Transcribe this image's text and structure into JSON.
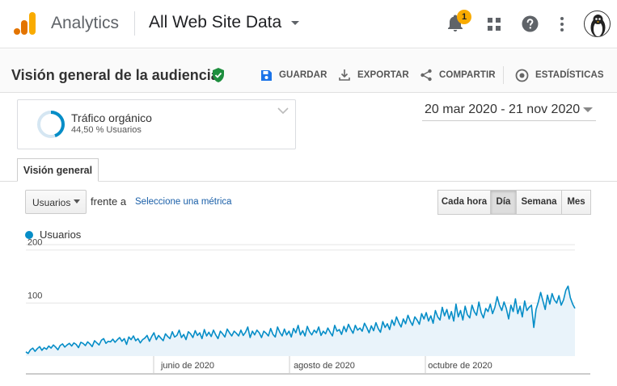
{
  "app": {
    "name": "Analytics",
    "property": "All Web Site Data",
    "notifications_count": "1"
  },
  "header": {
    "title": "Visión general de la audiencia",
    "save_label": "GUARDAR",
    "export_label": "EXPORTAR",
    "share_label": "COMPARTIR",
    "insights_label": "ESTADÍSTICAS"
  },
  "segment": {
    "name": "Tráfico orgánico",
    "share": "44,50 % Usuarios",
    "share_fraction": 0.445
  },
  "date_range": "20 mar 2020 - 21 nov 2020",
  "tabs": [
    "Visión general"
  ],
  "controls": {
    "metric": "Usuarios",
    "versus": "frente a",
    "select_metric": "Seleccione una métrica",
    "granularity": [
      "Cada hora",
      "Día",
      "Semana",
      "Mes"
    ],
    "granularity_selected": "Día"
  },
  "colors": {
    "brand_orange": "#f9ab00",
    "series_blue": "#058dc7",
    "area_fill": "#e9f3fa",
    "verified_green": "#1e8e3e"
  },
  "chart_data": {
    "type": "area",
    "series": [
      {
        "name": "Usuarios",
        "values": [
          8,
          5,
          12,
          15,
          9,
          14,
          18,
          11,
          16,
          13,
          19,
          15,
          21,
          17,
          12,
          20,
          23,
          17,
          21,
          24,
          19,
          25,
          22,
          16,
          26,
          24,
          20,
          27,
          23,
          18,
          29,
          25,
          21,
          30,
          33,
          24,
          28,
          27,
          32,
          26,
          31,
          35,
          28,
          33,
          22,
          36,
          31,
          38,
          29,
          33,
          25,
          31,
          34,
          39,
          28,
          37,
          44,
          31,
          39,
          34,
          29,
          42,
          37,
          33,
          46,
          36,
          39,
          49,
          35,
          41,
          31,
          46,
          42,
          35,
          48,
          39,
          44,
          33,
          50,
          38,
          45,
          37,
          49,
          40,
          33,
          47,
          42,
          36,
          51,
          44,
          38,
          47,
          43,
          38,
          49,
          39,
          45,
          55,
          35,
          47,
          40,
          49,
          44,
          35,
          47,
          43,
          38,
          52,
          41,
          36,
          55,
          45,
          38,
          51,
          40,
          47,
          36,
          52,
          44,
          58,
          40,
          48,
          38,
          56,
          46,
          40,
          49,
          44,
          55,
          39,
          47,
          42,
          53,
          45,
          38,
          58,
          47,
          50,
          41,
          56,
          46,
          60,
          51,
          43,
          58,
          49,
          53,
          47,
          62,
          54,
          44,
          57,
          48,
          63,
          52,
          45,
          65,
          54,
          61,
          50,
          68,
          58,
          74,
          63,
          55,
          70,
          61,
          77,
          66,
          58,
          74,
          68,
          60,
          80,
          70,
          82,
          66,
          76,
          62,
          86,
          74,
          68,
          92,
          76,
          88,
          70,
          84,
          66,
          98,
          74,
          86,
          68,
          94,
          78,
          72,
          96,
          84,
          77,
          102,
          82,
          72,
          90,
          84,
          98,
          80,
          92,
          112,
          96,
          86,
          102,
          90,
          70,
          96,
          84,
          108,
          80,
          94,
          74,
          104,
          86,
          92,
          96,
          54,
          88,
          102,
          120,
          104,
          88,
          115,
          98,
          118,
          106,
          100,
          114,
          96,
          106,
          124,
          132,
          110,
          98,
          90
        ]
      }
    ],
    "x_ticks": [
      "junio de 2020",
      "agosto de 2020",
      "octubre de 2020"
    ],
    "y_ticks": [
      100,
      200
    ],
    "ylim": [
      0,
      210
    ],
    "grid": true
  }
}
